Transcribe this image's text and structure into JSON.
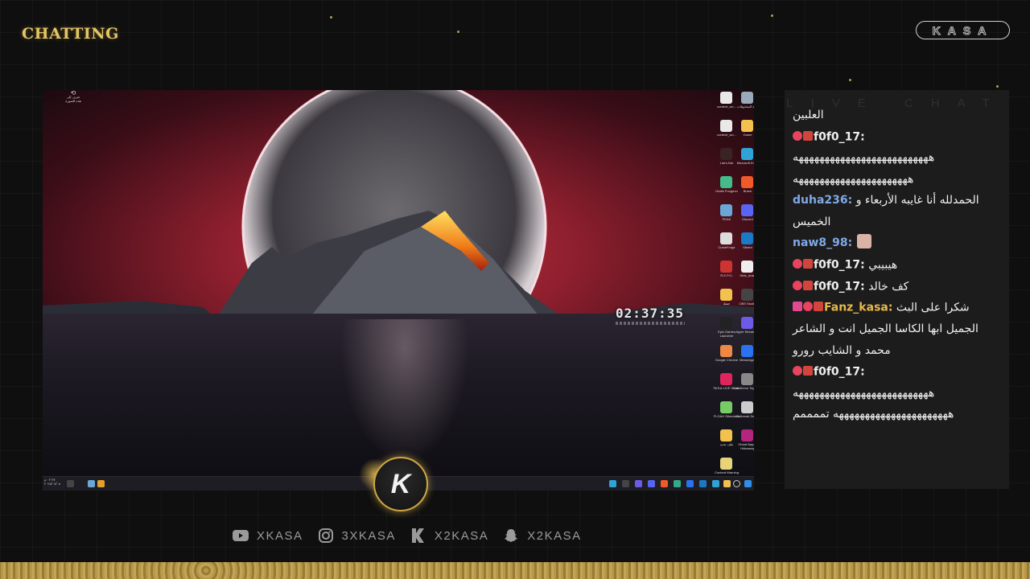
{
  "header": {
    "subtitle": "",
    "title": "CHATTING",
    "logo_text": "KASA"
  },
  "screen": {
    "clock": "02:37:35",
    "desktop_icons": [
      {
        "name": "content_wo...",
        "color": "#e9e9e9"
      },
      {
        "name": "سلة المحذوفات",
        "color": "#9ab"
      },
      {
        "name": "content_wo...",
        "color": "#e9e9e9"
      },
      {
        "name": "Game",
        "color": "#f2c14e"
      },
      {
        "name": "Liar's Bar",
        "color": "#3a2323"
      },
      {
        "name": "Microsoft Edge",
        "color": "#2fa3d6"
      },
      {
        "name": "Death Fungeon",
        "color": "#4b8"
      },
      {
        "name": "Brave",
        "color": "#f05a28"
      },
      {
        "name": "PEAK",
        "color": "#6aa7d8"
      },
      {
        "name": "Discord",
        "color": "#5865f2"
      },
      {
        "name": "CurseForge",
        "color": "#ddd"
      },
      {
        "name": "Steam",
        "color": "#1b7ac6"
      },
      {
        "name": "R.E.P.O.",
        "color": "#c33"
      },
      {
        "name": "Hide_draw",
        "color": "#eee"
      },
      {
        "name": "حفظ",
        "color": "#f2c14e"
      },
      {
        "name": "OBS Studio",
        "color": "#444"
      },
      {
        "name": "Epic Games Launcher",
        "color": "#222"
      },
      {
        "name": "Apple Stream Ja",
        "color": "#6b5be6"
      },
      {
        "name": "Google Chrome",
        "color": "#e84"
      },
      {
        "name": "Messenger",
        "color": "#2a72f0"
      },
      {
        "name": "TikTok LIVE Studio",
        "color": "#e0245e"
      },
      {
        "name": "Can Serve Together",
        "color": "#888"
      },
      {
        "name": "FLOAH Stimulator",
        "color": "#7c6"
      },
      {
        "name": "Outbreak Demo",
        "color": "#ccc"
      },
      {
        "name": "ملف جديد",
        "color": "#f2c14e"
      },
      {
        "name": "Ghost Bayou Hideaway",
        "color": "#b3257e"
      },
      {
        "name": "Content Warning",
        "color": "#e6d37a"
      }
    ],
    "recycle_label": "تعرف إلى هذه الصورة",
    "taskbar_time": "٠٢:٣٧ م",
    "taskbar_date": "٢٠٢٥/٠٧/٠٥"
  },
  "chat": {
    "header": "LIVE CHAT",
    "messages": [
      {
        "user": "",
        "text": "العلبين",
        "badges": [],
        "user_color": "#ffffff"
      },
      {
        "user": "f0f0_17:",
        "text": "ههههههههههههههههههههههههههه ههههههههههههههههههههههه",
        "badges": [
          "heart",
          "og"
        ],
        "user_color": "#f0f0f0"
      },
      {
        "user": "duha236:",
        "text": "الحمدلله أنا غايبه الأربعاء و الخميس",
        "badges": [],
        "user_color": "#7fa8e6"
      },
      {
        "user": "naw8_98:",
        "text": "",
        "badges": [],
        "user_color": "#7fa8e6",
        "avatar": true
      },
      {
        "user": "f0f0_17:",
        "text": "هيبيبي",
        "badges": [
          "heart",
          "og"
        ],
        "user_color": "#f0f0f0"
      },
      {
        "user": "f0f0_17:",
        "text": "كف خالد",
        "badges": [
          "heart",
          "og"
        ],
        "user_color": "#f0f0f0"
      },
      {
        "user": "Fanz_kasa:",
        "text": "شكرا على البث الجميل ابها الكاسا الجميل انت و الشاعر محمد و الشايب رورو",
        "badges": [
          "rocket",
          "heart",
          "og"
        ],
        "user_color": "#e9b949"
      },
      {
        "user": "f0f0_17:",
        "text": "ههههههههههههههههههههههههههه ههههههههههههههههههههههه تممممم",
        "badges": [
          "heart",
          "og"
        ],
        "user_color": "#f0f0f0"
      }
    ]
  },
  "center_badge": {
    "letter": "K"
  },
  "socials": [
    {
      "icon": "youtube-icon",
      "text": "XKASA"
    },
    {
      "icon": "instagram-icon",
      "text": "3XKASA"
    },
    {
      "icon": "kick-icon",
      "text": "X2KASA"
    },
    {
      "icon": "snapchat-icon",
      "text": "X2KASA"
    }
  ],
  "colors": {
    "gold": "#e4c464",
    "chat_bg": "#1c1c1c",
    "background": "#0f0f0f"
  }
}
